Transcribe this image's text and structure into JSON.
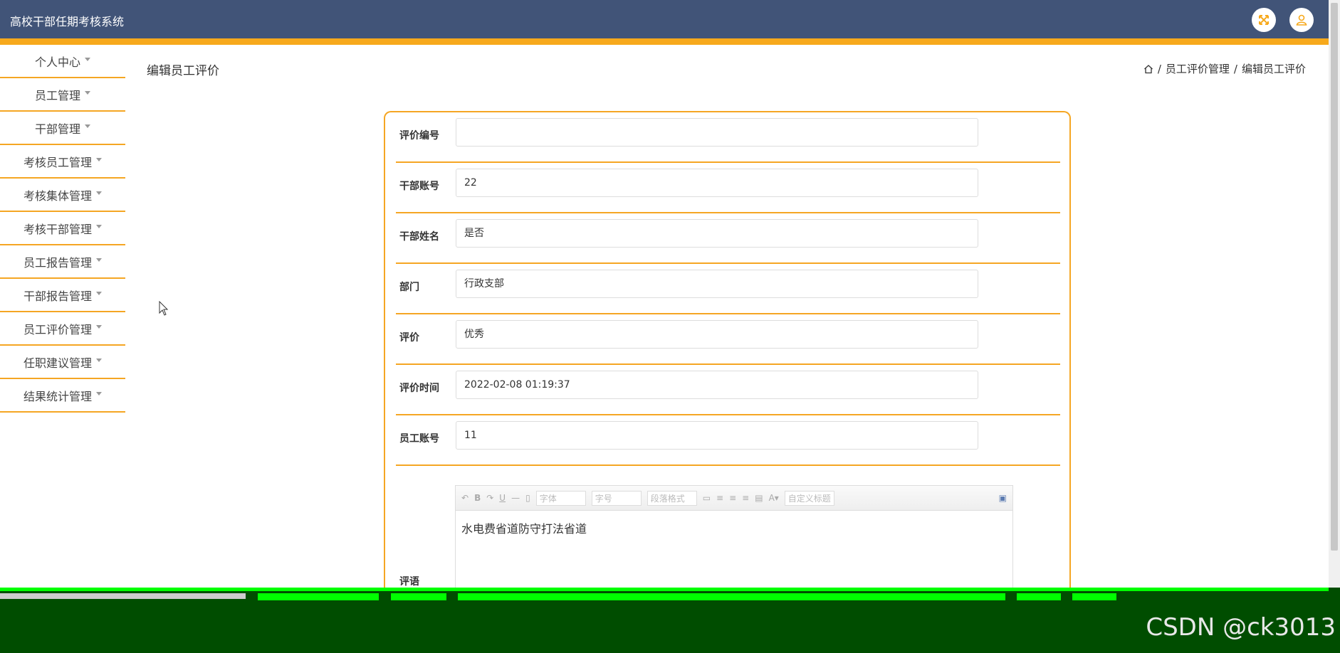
{
  "app": {
    "title": "高校干部任期考核系统"
  },
  "header": {
    "fullscreen_icon": "expand-icon",
    "user_icon": "user-icon"
  },
  "sidebar": {
    "items": [
      {
        "label": "个人中心"
      },
      {
        "label": "员工管理"
      },
      {
        "label": "干部管理"
      },
      {
        "label": "考核员工管理"
      },
      {
        "label": "考核集体管理"
      },
      {
        "label": "考核干部管理"
      },
      {
        "label": "员工报告管理"
      },
      {
        "label": "干部报告管理"
      },
      {
        "label": "员工评价管理"
      },
      {
        "label": "任职建议管理"
      },
      {
        "label": "结果统计管理"
      }
    ]
  },
  "page": {
    "title": "编辑员工评价",
    "breadcrumb": {
      "sep": "/",
      "level1": "员工评价管理",
      "level2": "编辑员工评价"
    }
  },
  "form": {
    "fields": [
      {
        "label": "评价编号",
        "value": ""
      },
      {
        "label": "干部账号",
        "value": "22"
      },
      {
        "label": "干部姓名",
        "value": "是否"
      },
      {
        "label": "部门",
        "value": "行政支部"
      },
      {
        "label": "评价",
        "value": "优秀"
      },
      {
        "label": "评价时间",
        "value": "2022-02-08 01:19:37"
      },
      {
        "label": "员工账号",
        "value": "11"
      }
    ],
    "comment": {
      "label": "评语",
      "toolbar": {
        "font": "字体",
        "size": "字号",
        "paragraph": "段落格式",
        "custom_title": "自定义标题"
      },
      "content": "水电费省道防守打法省道"
    }
  },
  "watermark": "CSDN @ck3013",
  "colors": {
    "header": "#415478",
    "accent": "#f7a91c",
    "border": "#f5a623"
  }
}
